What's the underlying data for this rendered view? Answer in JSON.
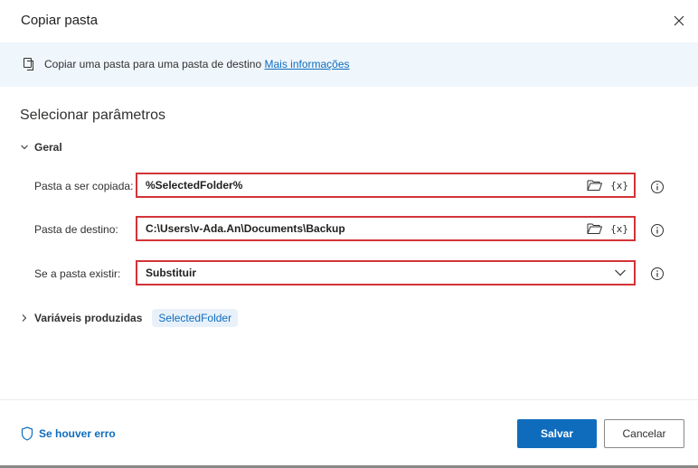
{
  "dialog": {
    "title": "Copiar pasta",
    "close_icon": "close-icon"
  },
  "info": {
    "icon": "copy-icon",
    "text": "Copiar uma pasta para uma pasta de destino",
    "link": "Mais informações"
  },
  "section_title": "Selecionar parâmetros",
  "general": {
    "label": "Geral",
    "fields": [
      {
        "label": "Pasta a ser copiada:",
        "value": "%SelectedFolder%",
        "icons": [
          "folder-icon",
          "variable-icon"
        ]
      },
      {
        "label": "Pasta de destino:",
        "value": "C:\\Users\\v-Ada.An\\Documents\\Backup",
        "icons": [
          "folder-icon",
          "variable-icon"
        ]
      },
      {
        "label": "Se a pasta existir:",
        "value": "Substituir",
        "icons": [
          "chevron-down-icon"
        ]
      }
    ],
    "variable_symbol": "{x}"
  },
  "produced": {
    "label": "Variáveis produzidas",
    "variable": "SelectedFolder"
  },
  "footer": {
    "on_error": "Se houver erro",
    "save": "Salvar",
    "cancel": "Cancelar"
  },
  "colors": {
    "accent": "#0f6cbd",
    "highlight_border": "#d13438",
    "info_bar": "#eff6fc"
  }
}
